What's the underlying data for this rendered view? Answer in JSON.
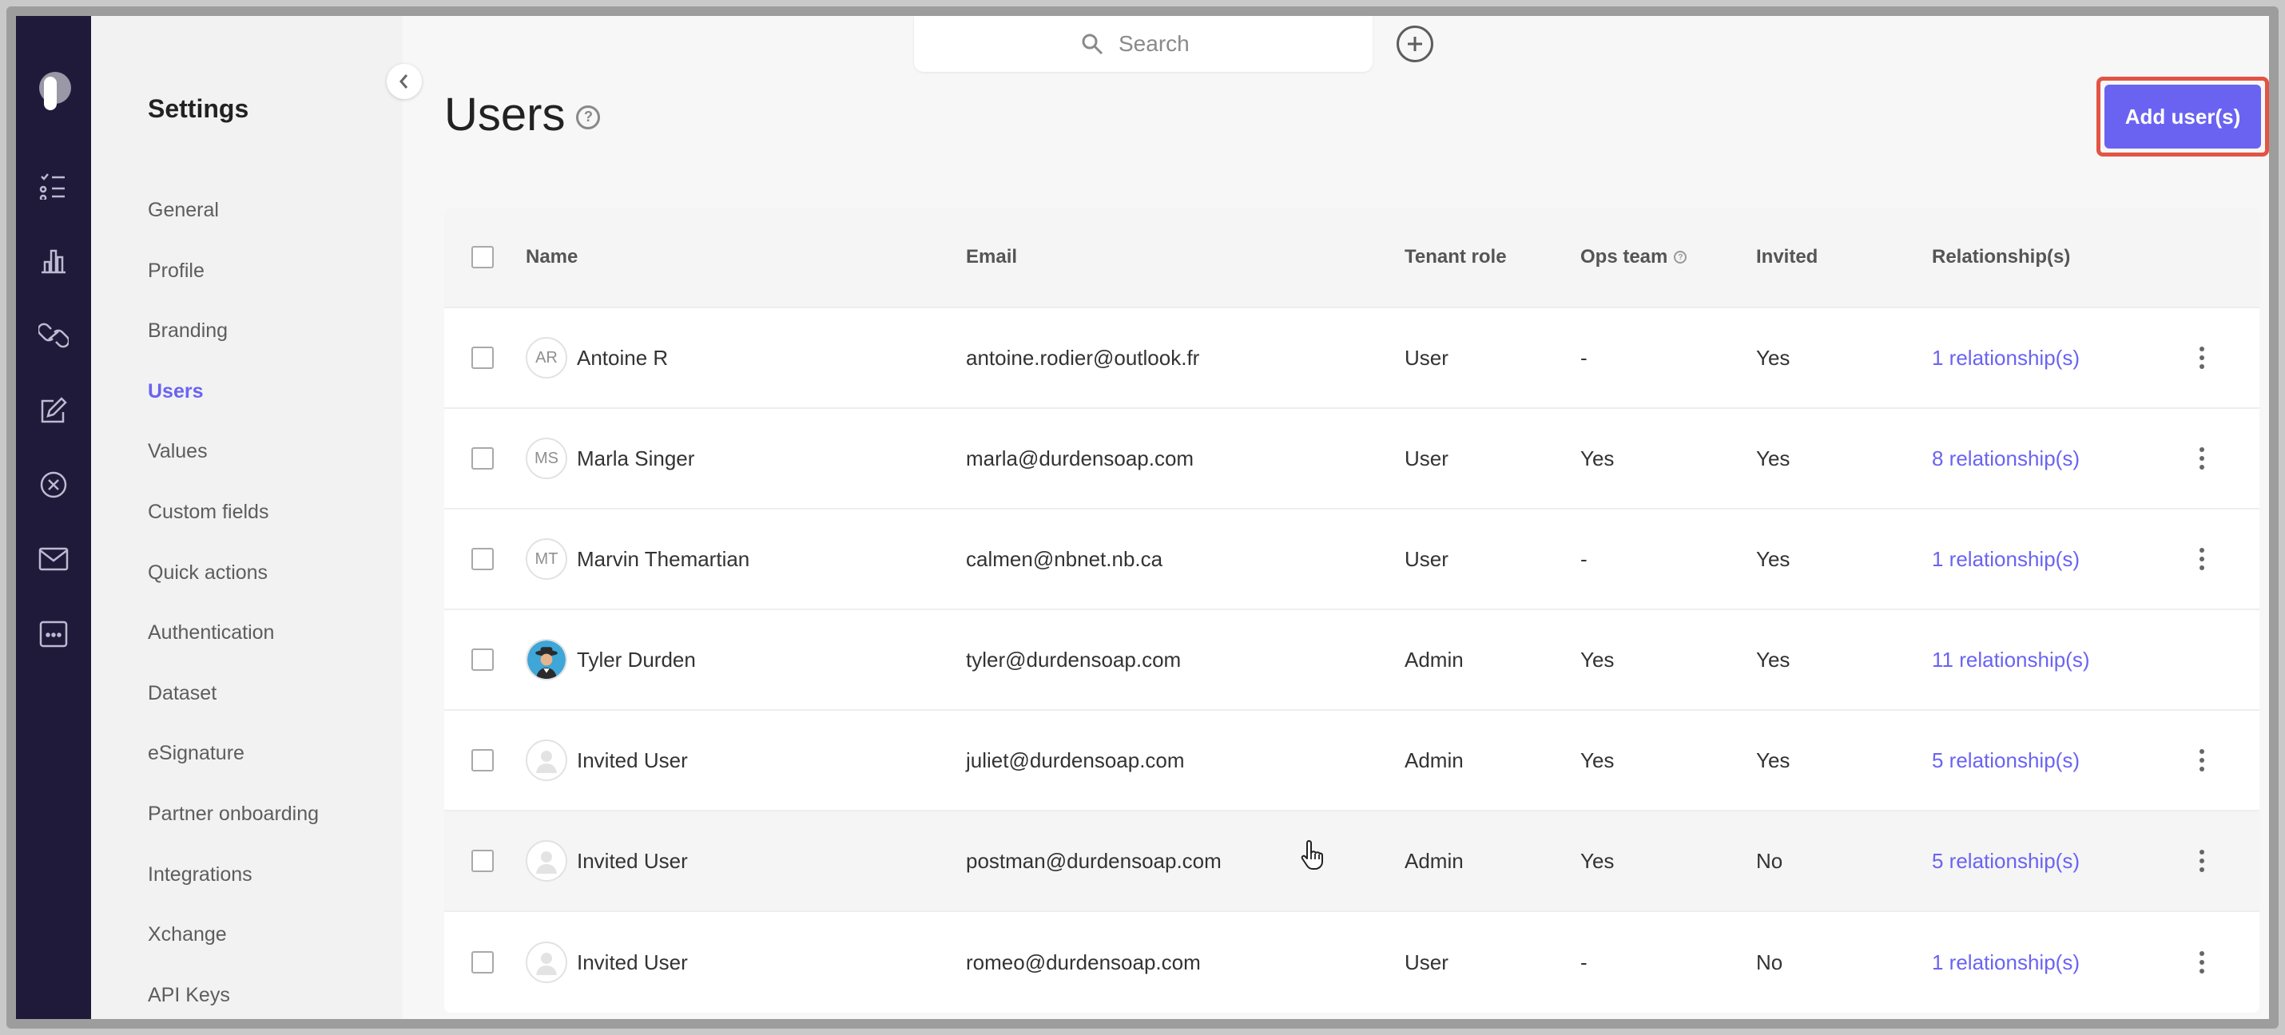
{
  "sidebar": {
    "title": "Settings",
    "items": [
      {
        "label": "General"
      },
      {
        "label": "Profile"
      },
      {
        "label": "Branding"
      },
      {
        "label": "Users",
        "active": true
      },
      {
        "label": "Values"
      },
      {
        "label": "Custom fields"
      },
      {
        "label": "Quick actions"
      },
      {
        "label": "Authentication"
      },
      {
        "label": "Dataset"
      },
      {
        "label": "eSignature"
      },
      {
        "label": "Partner onboarding"
      },
      {
        "label": "Integrations"
      },
      {
        "label": "Xchange"
      },
      {
        "label": "API Keys"
      }
    ]
  },
  "rail": {
    "icons": [
      "tasks-icon",
      "bar-chart-icon",
      "link-icon",
      "edit-icon",
      "ban-icon",
      "mail-icon",
      "more-apps-icon"
    ]
  },
  "search": {
    "placeholder": "Search"
  },
  "page": {
    "title": "Users",
    "add_button": "Add user(s)"
  },
  "table": {
    "headers": {
      "name": "Name",
      "email": "Email",
      "role": "Tenant role",
      "ops": "Ops team",
      "invited": "Invited",
      "relationships": "Relationship(s)"
    },
    "rows": [
      {
        "initials": "AR",
        "name": "Antoine R",
        "email": "antoine.rodier@outlook.fr",
        "role": "User",
        "ops": "-",
        "invited": "Yes",
        "relationships": "1 relationship(s)",
        "menu": true
      },
      {
        "initials": "MS",
        "name": "Marla Singer",
        "email": "marla@durdensoap.com",
        "role": "User",
        "ops": "Yes",
        "invited": "Yes",
        "relationships": "8 relationship(s)",
        "menu": true
      },
      {
        "initials": "MT",
        "name": "Marvin Themartian",
        "email": "calmen@nbnet.nb.ca",
        "role": "User",
        "ops": "-",
        "invited": "Yes",
        "relationships": "1 relationship(s)",
        "menu": true
      },
      {
        "initials": "",
        "avatar": "photo",
        "name": "Tyler Durden",
        "email": "tyler@durdensoap.com",
        "role": "Admin",
        "ops": "Yes",
        "invited": "Yes",
        "relationships": "11 relationship(s)",
        "menu": false
      },
      {
        "initials": "",
        "avatar": "placeholder",
        "name": "Invited User",
        "email": "juliet@durdensoap.com",
        "role": "Admin",
        "ops": "Yes",
        "invited": "Yes",
        "relationships": "5 relationship(s)",
        "menu": true
      },
      {
        "initials": "",
        "avatar": "placeholder",
        "name": "Invited User",
        "email": "postman@durdensoap.com",
        "role": "Admin",
        "ops": "Yes",
        "invited": "No",
        "relationships": "5 relationship(s)",
        "menu": true,
        "hover": true
      },
      {
        "initials": "",
        "avatar": "placeholder",
        "name": "Invited User",
        "email": "romeo@durdensoap.com",
        "role": "User",
        "ops": "-",
        "invited": "No",
        "relationships": "1 relationship(s)",
        "menu": true
      }
    ]
  },
  "colors": {
    "accent": "#6a63f2",
    "rail": "#1f1a3a",
    "highlight": "#e25445"
  }
}
